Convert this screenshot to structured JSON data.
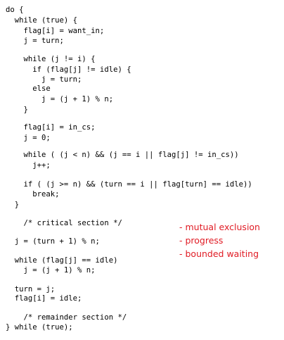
{
  "code_lines": [
    "do {",
    "  while (true) {",
    "    flag[i] = want_in;",
    "    j = turn;",
    "    while (j != i) {",
    "      if (flag[j] != idle) {",
    "        j = turn;",
    "      else",
    "        j = (j + 1) % n;",
    "    }",
    "    flag[i] = in_cs;",
    "    j = 0;",
    "    while ( (j < n) && (j == i || flag[j] != in_cs))",
    "      j++;",
    "    if ( (j >= n) && (turn == i || flag[turn] == idle))",
    "      break;",
    "  }",
    "    /* critical section */",
    "  j = (turn + 1) % n;",
    "  while (flag[j] == idle)",
    "    j = (j + 1) % n;",
    "  turn = j;",
    "  flag[i] = idle;",
    "    /* remainder section */",
    "} while (true);"
  ],
  "notes": [
    "- mutual exclusion",
    "- progress",
    "- bounded waiting"
  ],
  "colors": {
    "code_text": "#000000",
    "note_text": "#e01b24",
    "background": "#ffffff"
  }
}
